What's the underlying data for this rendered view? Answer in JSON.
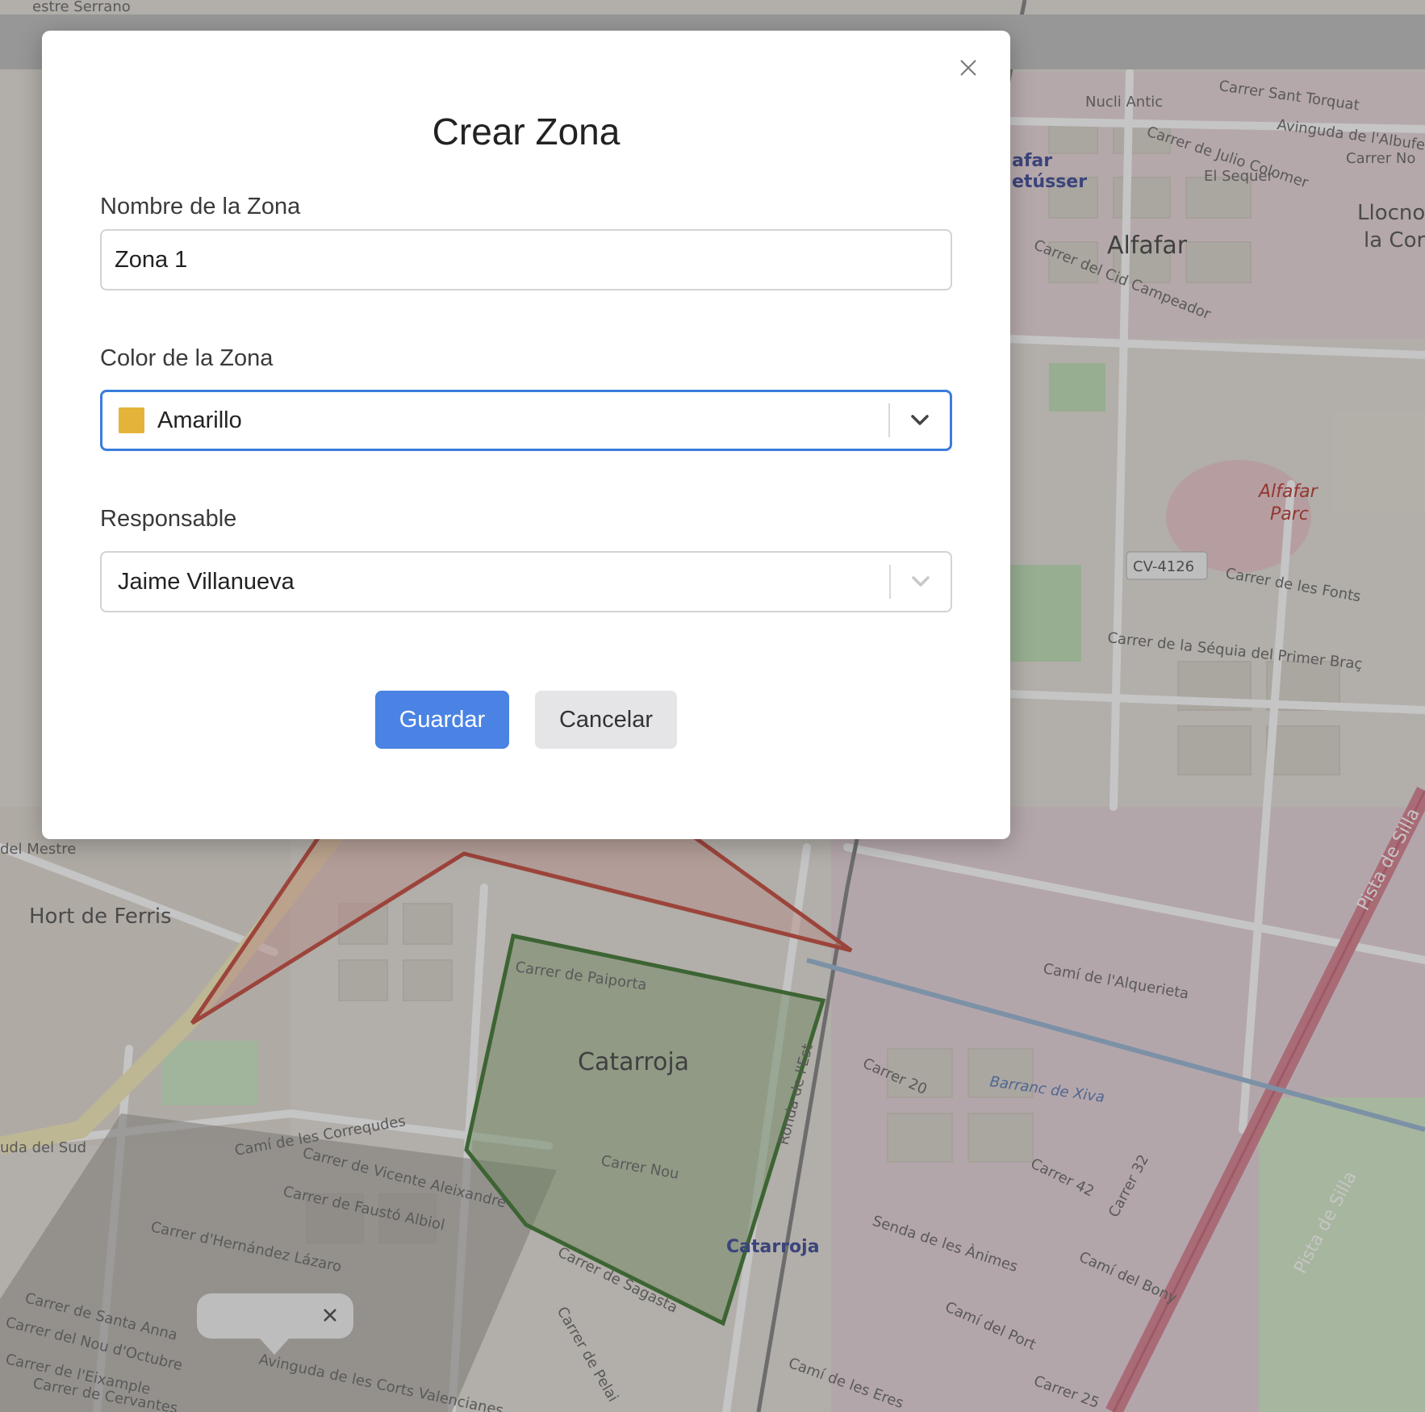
{
  "modal": {
    "title": "Crear Zona",
    "close_icon": "close-icon",
    "fields": {
      "zone_name": {
        "label": "Nombre de la Zona",
        "value": "Zona 1"
      },
      "zone_color": {
        "label": "Color de la Zona",
        "value": "Amarillo",
        "swatch_color": "#e4b43a"
      },
      "responsible": {
        "label": "Responsable",
        "value": "Jaime Villanueva"
      }
    },
    "buttons": {
      "save": "Guardar",
      "cancel": "Cancelar"
    },
    "accent_color": "#4a83e3"
  },
  "map": {
    "labels": {
      "catarroja": "Catarroja",
      "alfafar": "Alfafar",
      "nucli_antic": "Nucli Antic",
      "el_sequer": "El Sequer",
      "hort_de_ferris": "Hort de Ferris",
      "alfafar_parc_1": "Alfafar",
      "alfafar_parc_2": "Parc",
      "station_catarroja": "Catarroja",
      "station_alfafar_1": "afar",
      "station_alfafar_2": "etússer",
      "barranc": "Barranc de Xiva",
      "cv4126": "CV-4126",
      "pista_silla_1": "Pista de Silla",
      "pista_silla_2": "Pista de Silla",
      "avinguda_albufera": "Avinguda de l'Albufera",
      "carrer_sant_torquat": "Carrer Sant Torquat",
      "carrer_julio_colomer": "Carrer de Julio Colomer",
      "carrer_cid": "Carrer del Cid Campeador",
      "carrer_fonts": "Carrer de les Fonts",
      "carrer_sequia": "Carrer de la Séquia del Primer Braç",
      "cami_alquerieta": "Camí de l'Alquerieta",
      "carrer_palporta": "Carrer de Paiporta",
      "carrer_nou": "Carrer Nou",
      "cami_correqudes": "Camí de les Correqudes",
      "carrer_vicente": "Carrer de Vicente Aleixandre",
      "carrer_fausto": "Carrer de Faustó Albiol",
      "carrer_hernandez": "Carrer d'Hernández Lázaro",
      "carrer_santa_anna": "Carrer de Santa Anna",
      "carrer_nou_octubre": "Carrer del Nou d'Octubre",
      "carrer_eixample": "Carrer de l'Eixample",
      "carrer_cervantes": "Carrer de Cervantes",
      "avinguda_corts": "Avinguda de les Corts Valencianes",
      "carrer_sagasta": "Carrer de Sagasta",
      "carrer_pelai": "Carrer de Pelai",
      "ronda_est": "Ronda de l'Est",
      "senda_animes": "Senda de les Ànimes",
      "cami_bony": "Camí del Bony",
      "cami_port": "Camí del Port",
      "cami_eres": "Camí de les Eres",
      "avinguda_sud": "uda del Sud",
      "del_mestre": "del Mestre",
      "ve_serrano": "estre Serrano",
      "carrer_42": "Carrer 42",
      "carrer_32": "Carrer 32",
      "carrer_20": "Carrer 20",
      "carrer_25": "Carrer 25",
      "lloc_1": "Llocno",
      "lloc_2": "la Cor",
      "carrer_no": "Carrer No"
    },
    "zone_colors": {
      "red": "#c0392b",
      "green": "#3c6f2a"
    }
  },
  "popup": {
    "close_icon": "close-icon"
  }
}
